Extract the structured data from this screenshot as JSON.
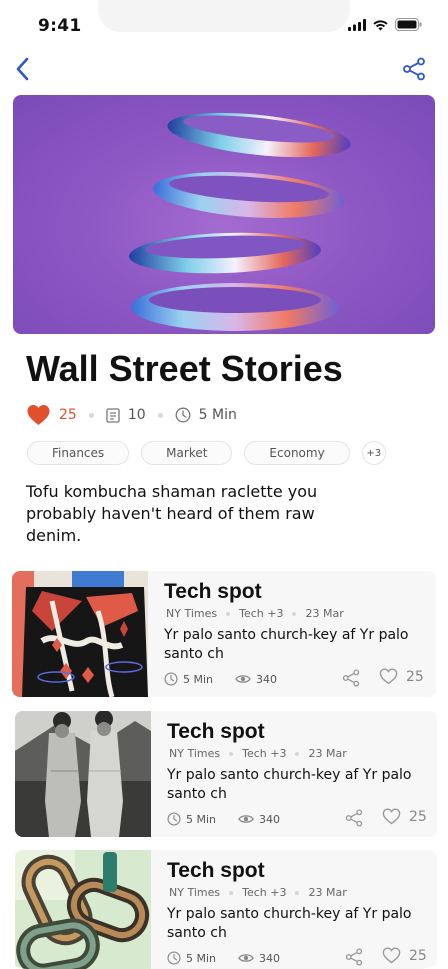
{
  "status_bar": {
    "time": "9:41"
  },
  "nav": {
    "back_icon": "chevron-left-icon",
    "share_icon": "share-icon",
    "accent": "#2f55d4"
  },
  "article": {
    "title": "Wall Street Stories",
    "likes": "25",
    "comments": "10",
    "read_time": "5 Min",
    "tags": [
      "Finances",
      "Market",
      "Economy"
    ],
    "tags_more": "+3",
    "description": "Tofu kombucha shaman raclette you probably haven't heard of them raw denim."
  },
  "cards": [
    {
      "title": "Tech spot",
      "source": "NY Times",
      "category": "Tech +3",
      "date": "23 Mar",
      "body": "Yr palo santo church-key af Yr palo santo ch",
      "read_time": "5 Min",
      "views": "340",
      "likes": "25",
      "thumb": "abstract-art"
    },
    {
      "title": "Tech spot",
      "source": "NY Times",
      "category": "Tech +3",
      "date": "23 Mar",
      "body": "Yr palo santo church-key af Yr palo santo ch",
      "read_time": "5 Min",
      "views": "340",
      "likes": "25",
      "thumb": "vintage-photo"
    },
    {
      "title": "Tech spot",
      "source": "NY Times",
      "category": "Tech +3",
      "date": "23 Mar",
      "body": "Yr palo santo church-key af Yr palo santo ch",
      "read_time": "5 Min",
      "views": "340",
      "likes": "25",
      "thumb": "chain-links"
    }
  ],
  "colors": {
    "heart": "#e0502d",
    "accent": "#2f55d4"
  }
}
